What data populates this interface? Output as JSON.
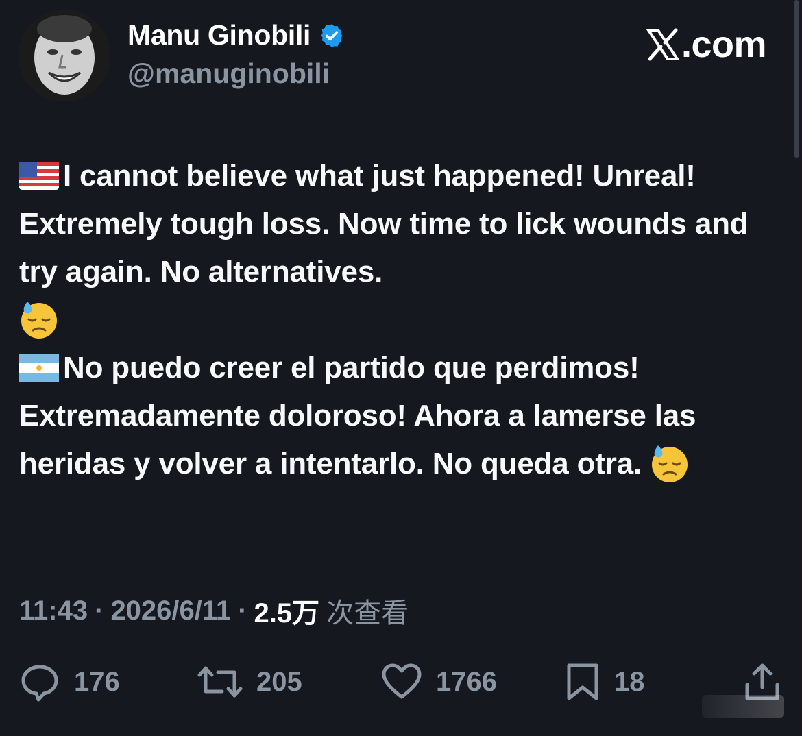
{
  "author": {
    "name": "Manu Ginobili",
    "handle": "@manuginobili",
    "verified": true,
    "avatar_icon": "avatar-photo"
  },
  "brand": {
    "text": ".com",
    "icon": "x-logo-icon"
  },
  "post": {
    "paragraphs": [
      {
        "flag": "us-flag-icon",
        "text": "I cannot believe what just happened! Unreal! Extremely tough loss. Now time to lick wounds and try again. No alternatives.",
        "end_emoji": "downcast-sweat-face-emoji"
      },
      {
        "flag": "argentina-flag-icon",
        "text": "No puedo creer el partido que perdimos! Extremadamente doloroso! Ahora a lamerse las heridas y volver a intentarlo. No queda otra.",
        "end_emoji": "downcast-sweat-face-emoji"
      }
    ]
  },
  "meta": {
    "time": "11:43",
    "separator": "·",
    "date": "2026/6/11",
    "views_count": "2.5万",
    "views_suffix": "次查看"
  },
  "actions": {
    "replies": "176",
    "reposts": "205",
    "likes": "1766",
    "bookmarks": "18"
  },
  "colors": {
    "background": "#15181f",
    "text": "#f7f8f9",
    "muted": "#8b95a1",
    "verified_blue": "#1d9bf0"
  }
}
